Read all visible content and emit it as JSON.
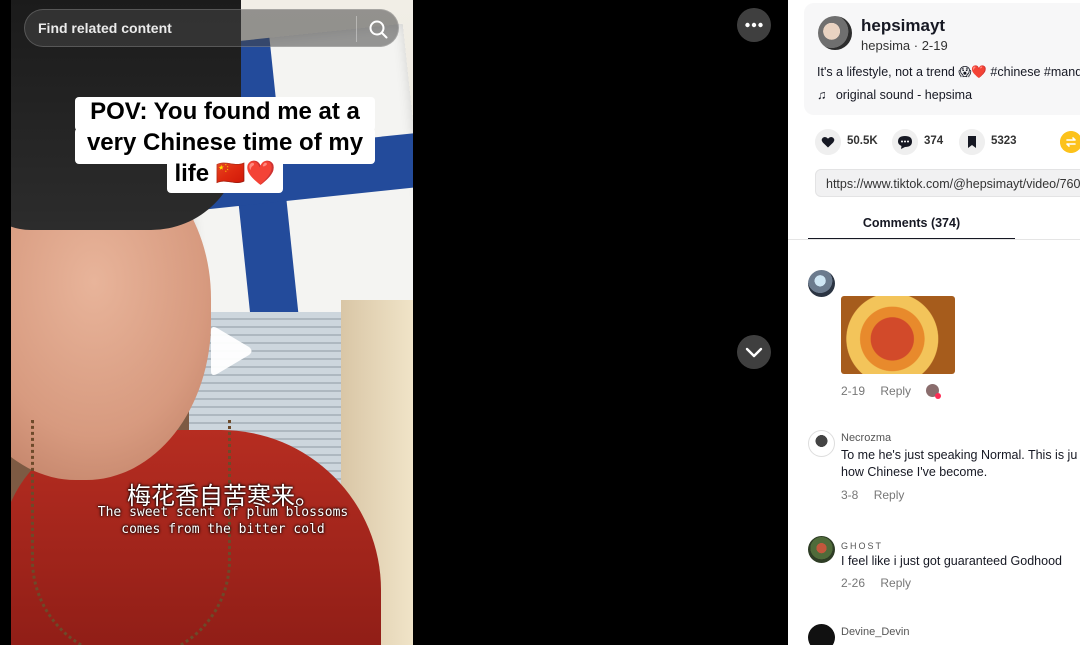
{
  "search": {
    "placeholder": "Find related content"
  },
  "video": {
    "caption_lines": [
      "POV: You found me at a",
      "very Chinese time of my",
      "life 🇨🇳❤️"
    ],
    "subtitle_cn": "梅花香自苦寒来。",
    "subtitle_en": [
      "The sweet scent of plum blossoms",
      "comes from the bitter cold"
    ]
  },
  "author": {
    "handle": "hepsimayt",
    "meta": "hepsima · 2-19",
    "description": "It's a lifestyle, not a trend 😱❤️ #chinese #mand",
    "music": "original sound - hepsima"
  },
  "stats": {
    "likes": "50.5K",
    "comments": "374",
    "saves": "5323"
  },
  "link": {
    "url": "https://www.tiktok.com/@hepsimayt/video/760"
  },
  "tabs": {
    "comments": "Comments (374)"
  },
  "comments": [
    {
      "user": "",
      "text": "",
      "date": "2-19",
      "reply": "Reply"
    },
    {
      "user": "Necrozma",
      "text": "To me he's just speaking Normal. This is ju how Chinese I've become.",
      "date": "3-8",
      "reply": "Reply"
    },
    {
      "user": "GHOST",
      "text": "I feel like i just got guaranteed Godhood",
      "date": "2-26",
      "reply": "Reply"
    },
    {
      "user": "Devine_Devin",
      "text": "",
      "date": "",
      "reply": ""
    }
  ],
  "colors": {
    "accent": "#fe2c55",
    "share": "#fcc21b",
    "flag_blue": "#234b9b"
  },
  "icons": [
    "search-icon",
    "play-icon",
    "more-icon",
    "chevron-down-icon",
    "heart-icon",
    "comment-icon",
    "bookmark-icon",
    "share-icon",
    "music-note-icon"
  ]
}
